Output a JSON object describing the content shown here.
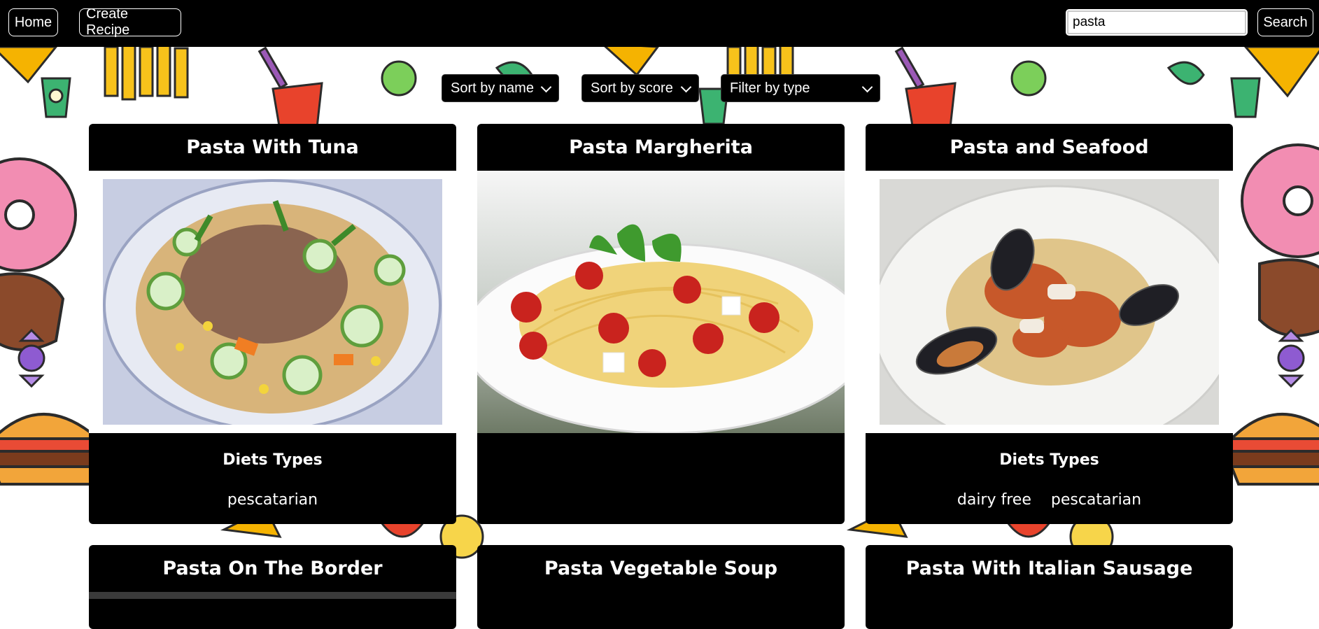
{
  "nav": {
    "home_label": "Home",
    "create_label": "Create Recipe",
    "search_value": "pasta",
    "search_button": "Search"
  },
  "filters": {
    "sort_name": "Sort by name",
    "sort_score": "Sort by score",
    "filter_type": "Filter by type"
  },
  "recipes": [
    {
      "title": "Pasta With Tuna",
      "diet_heading": "Diets Types",
      "diets": [
        "pescatarian"
      ]
    },
    {
      "title": "Pasta Margherita",
      "diet_heading": "",
      "diets": []
    },
    {
      "title": "Pasta and Seafood",
      "diet_heading": "Diets Types",
      "diets": [
        "dairy free",
        "pescatarian"
      ]
    },
    {
      "title": "Pasta On The Border"
    },
    {
      "title": "Pasta Vegetable Soup"
    },
    {
      "title": "Pasta With Italian Sausage"
    }
  ],
  "colors": {
    "nav_bg": "#000000",
    "card_bg": "#000000",
    "text": "#ffffff"
  }
}
